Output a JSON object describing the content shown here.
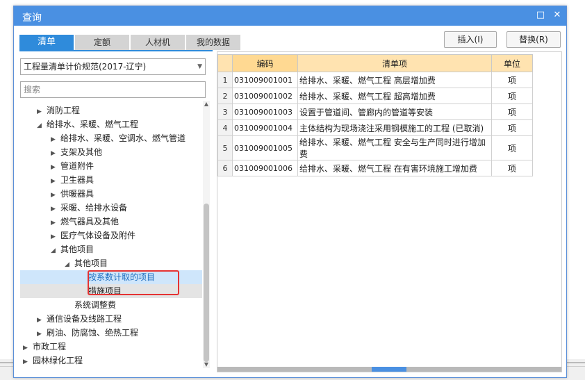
{
  "window": {
    "title": "查询",
    "restore_icon": "restore-icon",
    "close_icon": "close-icon"
  },
  "tabs": [
    {
      "label": "清单",
      "active": true
    },
    {
      "label": "定额",
      "active": false
    },
    {
      "label": "人材机",
      "active": false
    },
    {
      "label": "我的数据",
      "active": false
    }
  ],
  "buttons": {
    "insert": "插入(I)",
    "replace": "替换(R)"
  },
  "left": {
    "standard_select": "工程量清单计价规范(2017-辽宁)",
    "search_placeholder": "搜索",
    "tree": [
      {
        "label": "消防工程",
        "level": 1,
        "state": "collapsed"
      },
      {
        "label": "给排水、采暖、燃气工程",
        "level": 1,
        "state": "expanded"
      },
      {
        "label": "给排水、采暖、空调水、燃气管道",
        "level": 2,
        "state": "collapsed"
      },
      {
        "label": "支架及其他",
        "level": 2,
        "state": "collapsed"
      },
      {
        "label": "管道附件",
        "level": 2,
        "state": "collapsed"
      },
      {
        "label": "卫生器具",
        "level": 2,
        "state": "collapsed"
      },
      {
        "label": "供暖器具",
        "level": 2,
        "state": "collapsed"
      },
      {
        "label": "采暖、给排水设备",
        "level": 2,
        "state": "collapsed"
      },
      {
        "label": "燃气器具及其他",
        "level": 2,
        "state": "collapsed"
      },
      {
        "label": "医疗气体设备及附件",
        "level": 2,
        "state": "collapsed"
      },
      {
        "label": "其他项目",
        "level": 2,
        "state": "expanded"
      },
      {
        "label": "其他项目",
        "level": 3,
        "state": "expanded"
      },
      {
        "label": "按系数计取的项目",
        "level": 4,
        "state": "leaf",
        "selected": true
      },
      {
        "label": "措施项目",
        "level": 4,
        "state": "leaf"
      },
      {
        "label": "系统调整费",
        "level": 3,
        "state": "leaf"
      },
      {
        "label": "通信设备及线路工程",
        "level": 1,
        "state": "collapsed"
      },
      {
        "label": "刷油、防腐蚀、绝热工程",
        "level": 1,
        "state": "collapsed"
      },
      {
        "label": "市政工程",
        "level": 0,
        "state": "collapsed"
      },
      {
        "label": "园林绿化工程",
        "level": 0,
        "state": "collapsed"
      }
    ]
  },
  "grid": {
    "headers": {
      "code": "编码",
      "item": "清单项",
      "unit": "单位"
    },
    "rows": [
      {
        "no": "1",
        "code": "031009001001",
        "item": "给排水、采暖、燃气工程 高层增加费",
        "unit": "项"
      },
      {
        "no": "2",
        "code": "031009001002",
        "item": "给排水、采暖、燃气工程 超高增加费",
        "unit": "项"
      },
      {
        "no": "3",
        "code": "031009001003",
        "item": "设置于管道间、管廊内的管道等安装",
        "unit": "项"
      },
      {
        "no": "4",
        "code": "031009001004",
        "item": "主体结构为现场浇注采用钢模施工的工程 (已取消)",
        "unit": "项"
      },
      {
        "no": "5",
        "code": "031009001005",
        "item": "给排水、采暖、燃气工程 安全与生产同时进行增加费",
        "unit": "项"
      },
      {
        "no": "6",
        "code": "031009001006",
        "item": "给排水、采暖、燃气工程 在有害环境施工增加费",
        "unit": "项"
      }
    ]
  }
}
